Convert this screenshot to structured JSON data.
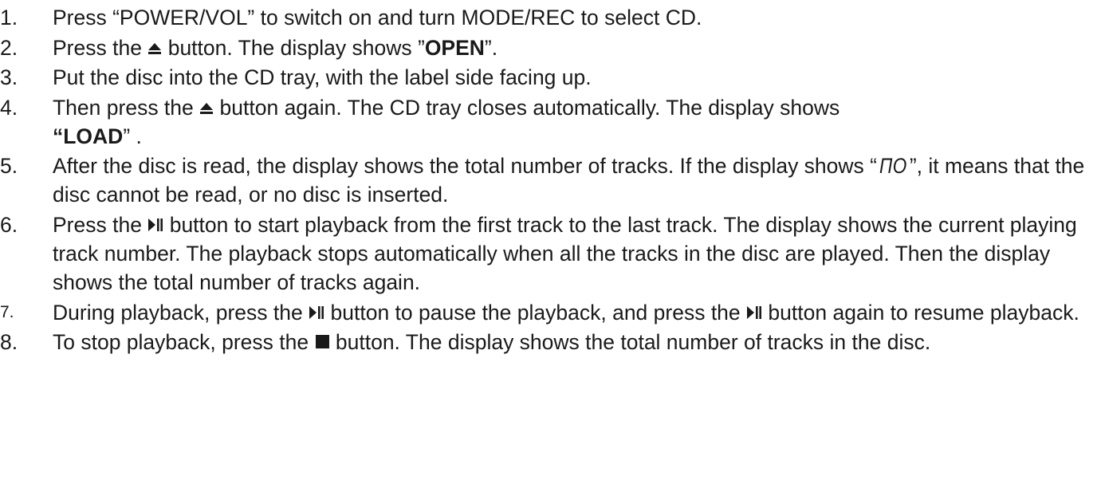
{
  "steps": [
    {
      "number": "1.",
      "parts": {
        "t1": "Press “POWER/VOL” to switch on and turn MODE/REC to select CD."
      }
    },
    {
      "number": "2.",
      "parts": {
        "t1": "Press the",
        "icon": "eject-icon",
        "t2": "button. The display shows ”",
        "b1": "OPEN",
        "t3": "”."
      }
    },
    {
      "number": "3.",
      "parts": {
        "t1": "Put the disc into the CD tray, with the label side facing up."
      }
    },
    {
      "number": "4.",
      "parts": {
        "t1": "Then press the",
        "icon": "eject-icon",
        "t2": "button again. The CD tray closes automatically. The display shows",
        "b1": "“LOAD",
        "t3": "” ."
      }
    },
    {
      "number": "5.",
      "parts": {
        "t1": "After the disc is read, the display shows the total number of tracks. If the display shows “",
        "seg": "ПО",
        "t2": "”, it means that the disc cannot be read, or no disc is inserted."
      }
    },
    {
      "number": "6.",
      "parts": {
        "t1": "Press the",
        "icon": "play-pause-icon",
        "t2": "button to start playback from the first track to the last track. The display shows the current playing track number. The playback stops automatically when all the tracks in the disc are played. Then the display shows the total number of tracks again."
      }
    },
    {
      "number": "7.",
      "parts": {
        "t1": "During playback, press the",
        "icon1": "play-pause-icon",
        "t2": "button to pause the playback, and press the",
        "icon2": "play-pause-icon",
        "t3": "button again to resume playback."
      }
    },
    {
      "number": "8.",
      "parts": {
        "t1": "To stop playback, press the",
        "icon": "stop-icon",
        "t2": "button. The display shows the total number of tracks in the disc."
      }
    }
  ]
}
